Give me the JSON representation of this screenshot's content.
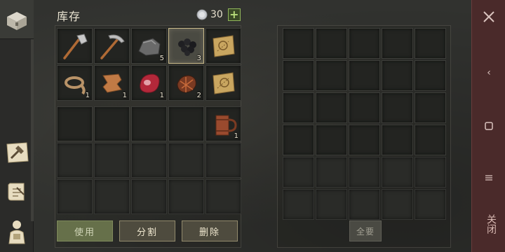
{
  "header": {
    "title": "库存",
    "currency_amount": "30",
    "add_label": "+"
  },
  "rail": {
    "icons": [
      "chest-icon",
      "crafting-map-icon",
      "quest-scroll-icon",
      "backpack-character-icon"
    ]
  },
  "inventory": {
    "items": [
      {
        "name": "hammer",
        "icon": "hammer-icon",
        "count": ""
      },
      {
        "name": "pickaxe",
        "icon": "pickaxe-icon",
        "count": ""
      },
      {
        "name": "stone",
        "icon": "stone-icon",
        "count": "5"
      },
      {
        "name": "coal",
        "icon": "coal-icon",
        "count": "3",
        "selected": true
      },
      {
        "name": "map-scroll",
        "icon": "treasure-map-icon",
        "count": ""
      },
      {
        "name": "rope",
        "icon": "rope-icon",
        "count": "1"
      },
      {
        "name": "leather",
        "icon": "leather-icon",
        "count": "1"
      },
      {
        "name": "raw-meat",
        "icon": "raw-meat-icon",
        "count": "1"
      },
      {
        "name": "grilled-meat",
        "icon": "grilled-meat-icon",
        "count": "2"
      },
      {
        "name": "map-scroll-2",
        "icon": "treasure-map-icon",
        "count": ""
      }
    ],
    "equip_items": [
      {
        "slot": 4,
        "name": "wooden-mug",
        "icon": "mug-icon",
        "count": "1"
      }
    ]
  },
  "buttons": {
    "use": "使用",
    "split": "分割",
    "delete": "删除",
    "take_all": "全要"
  },
  "close_bar": {
    "label": "关闭"
  },
  "colors": {
    "accent_green": "#90b55a",
    "close_bar": "#4a2a2a",
    "selected_border": "#c8b98a"
  }
}
